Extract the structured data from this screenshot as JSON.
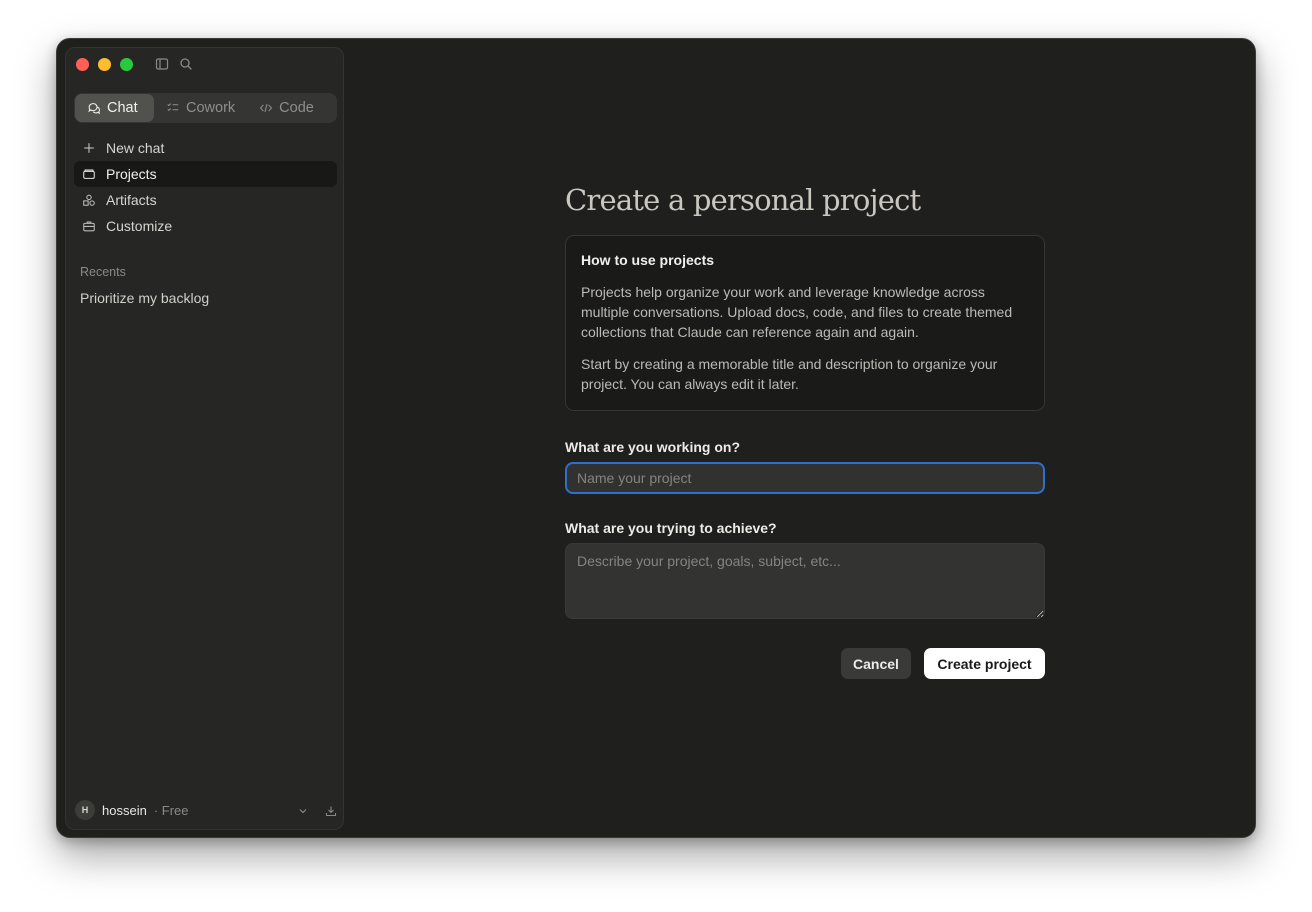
{
  "window": {
    "controls": [
      "close",
      "minimize",
      "maximize"
    ],
    "toolbar_icons": [
      "sidebar-toggle-icon",
      "search-icon"
    ]
  },
  "sidebar": {
    "mode_tabs": [
      {
        "label": "Chat",
        "icon": "chat-bubbles-icon",
        "active": true
      },
      {
        "label": "Cowork",
        "icon": "checklist-icon",
        "active": false
      },
      {
        "label": "Code",
        "icon": "code-icon",
        "active": false
      }
    ],
    "nav": [
      {
        "label": "New chat",
        "icon": "plus-icon",
        "active": false
      },
      {
        "label": "Projects",
        "icon": "folder-icon",
        "active": true
      },
      {
        "label": "Artifacts",
        "icon": "shapes-icon",
        "active": false
      },
      {
        "label": "Customize",
        "icon": "briefcase-icon",
        "active": false
      }
    ],
    "recents_title": "Recents",
    "recents": [
      "Prioritize my backlog"
    ],
    "user": {
      "initial": "H",
      "name": "hossein",
      "plan": "· Free"
    }
  },
  "main": {
    "title": "Create a personal project",
    "info": {
      "title": "How to use projects",
      "paragraph1": "Projects help organize your work and leverage knowledge across multiple conversations. Upload docs, code, and files to create themed collections that Claude can reference again and again.",
      "paragraph2": "Start by creating a memorable title and description to organize your project. You can always edit it later."
    },
    "name_label": "What are you working on?",
    "name_placeholder": "Name your project",
    "name_value": "",
    "desc_label": "What are you trying to achieve?",
    "desc_placeholder": "Describe your project, goals, subject, etc...",
    "desc_value": "",
    "cancel_label": "Cancel",
    "create_label": "Create project"
  },
  "colors": {
    "window_bg": "#1f1f1e",
    "sidebar_bg": "#262624",
    "focus_ring": "#2f6fd0",
    "primary_button_bg": "#ffffff"
  }
}
